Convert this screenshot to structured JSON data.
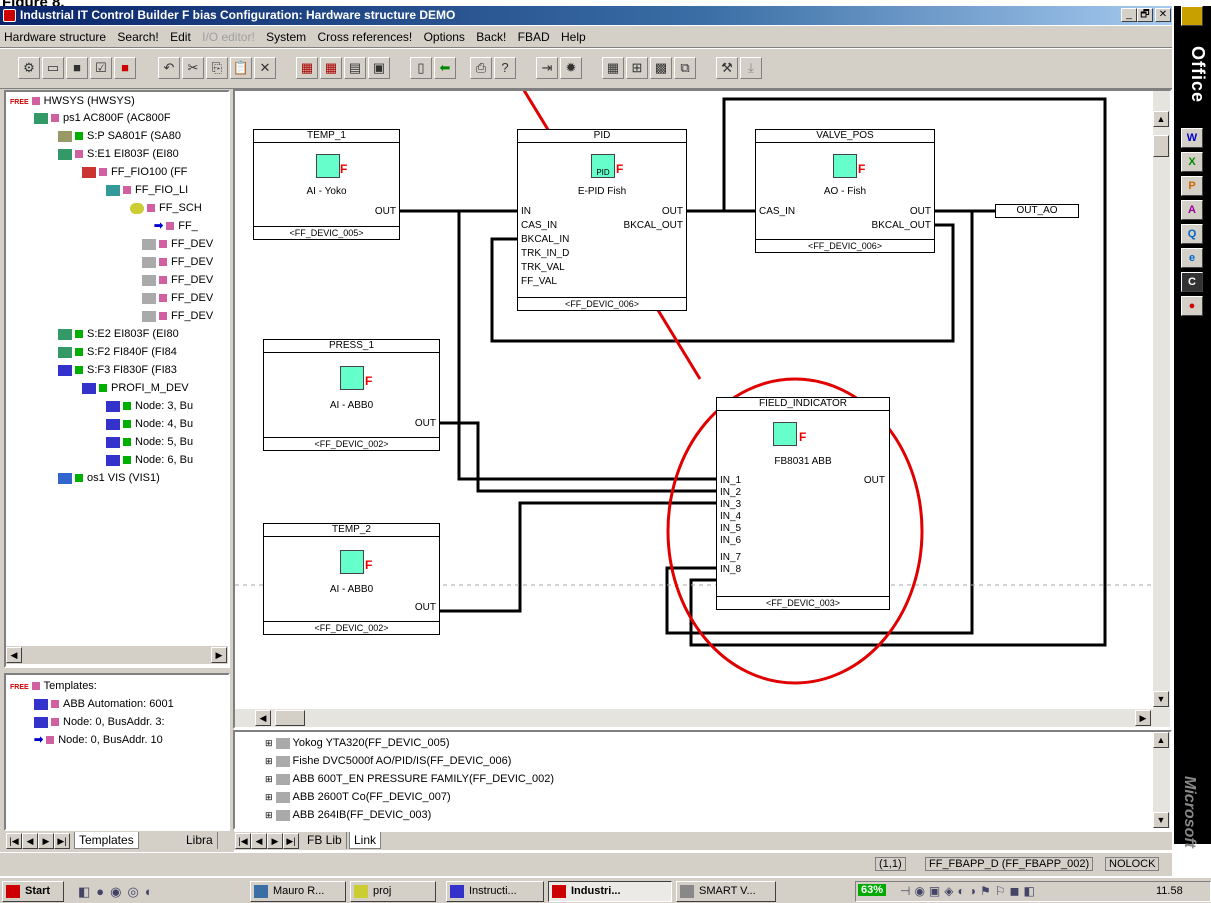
{
  "figure_label": "Figure 8.",
  "window": {
    "title": "Industrial IT Control Builder F bias  Configuration: Hardware structure  DEMO",
    "controls": [
      "_",
      "🗗",
      "✕"
    ]
  },
  "menu": [
    "Hardware structure",
    "Search!",
    "Edit",
    "I/O editor!",
    "System",
    "Cross references!",
    "Options",
    "Back!",
    "FBAD",
    "Help"
  ],
  "hw_tree": [
    {
      "label": "HWSYS (HWSYS)",
      "color": "pink",
      "prefix": "FREE"
    },
    {
      "label": "ps1  AC800F (AC800F",
      "color": "pink"
    },
    {
      "label": "S:P  SA801F (SA80",
      "color": "green"
    },
    {
      "label": "S:E1  EI803F (EI80",
      "color": "pink"
    },
    {
      "label": "FF_FIO100 (FF",
      "color": "pink"
    },
    {
      "label": "FF_FIO_LI",
      "color": "pink"
    },
    {
      "label": "FF_SCH",
      "color": "pink"
    },
    {
      "label": "FF_",
      "color": "pink"
    },
    {
      "label": "FF_DEV",
      "color": "pink"
    },
    {
      "label": "FF_DEV",
      "color": "pink"
    },
    {
      "label": "FF_DEV",
      "color": "pink"
    },
    {
      "label": "FF_DEV",
      "color": "pink"
    },
    {
      "label": "FF_DEV",
      "color": "pink"
    },
    {
      "label": "S:E2  EI803F (EI80",
      "color": "green"
    },
    {
      "label": "S:F2  FI840F (FI84",
      "color": "green"
    },
    {
      "label": "S:F3  FI830F (FI83",
      "color": "green"
    },
    {
      "label": "PROFI_M_DEV",
      "color": "green"
    },
    {
      "label": "Node: 3, Bu",
      "color": "green"
    },
    {
      "label": "Node: 4, Bu",
      "color": "green"
    },
    {
      "label": "Node: 5, Bu",
      "color": "green"
    },
    {
      "label": "Node: 6, Bu",
      "color": "green"
    },
    {
      "label": "os1  VIS (VIS1)",
      "color": "green"
    }
  ],
  "templates_tree": [
    {
      "label": "Templates:",
      "prefix": "FREE"
    },
    {
      "label": "ABB Automation: 6001"
    },
    {
      "label": "Node: 0, BusAddr. 3:"
    },
    {
      "label": "Node: 0, BusAddr. 10"
    }
  ],
  "left_tabs": [
    "Templates",
    "Libra"
  ],
  "blocks": {
    "temp1": {
      "title": "TEMP_1",
      "name": "AI - Yoko",
      "out": "OUT",
      "footer": "<FF_DEVIC_005>"
    },
    "pid": {
      "title": "PID",
      "name": "E-PID Fish",
      "inputs": [
        "IN",
        "CAS_IN",
        "BKCAL_IN",
        "TRK_IN_D",
        "TRK_VAL",
        "FF_VAL"
      ],
      "out1": "OUT",
      "out2": "BKCAL_OUT",
      "footer": "<FF_DEVIC_006>",
      "icon": "PID"
    },
    "valve": {
      "title": "VALVE_POS",
      "name": "AO - Fish",
      "in": "CAS_IN",
      "out1": "OUT",
      "out2": "BKCAL_OUT",
      "footer": "<FF_DEVIC_006>"
    },
    "out_ao": {
      "label": "OUT_AO"
    },
    "press1": {
      "title": "PRESS_1",
      "name": "AI - ABB0",
      "out": "OUT",
      "footer": "<FF_DEVIC_002>"
    },
    "temp2": {
      "title": "TEMP_2",
      "name": "AI - ABB0",
      "out": "OUT",
      "footer": "<FF_DEVIC_002>"
    },
    "field": {
      "title": "FIELD_INDICATOR",
      "name": "FB8031 ABB",
      "inputs": [
        "IN_1",
        "IN_2",
        "IN_3",
        "IN_4",
        "IN_5",
        "IN_6",
        "IN_7",
        "IN_8"
      ],
      "out": "OUT",
      "footer": "<FF_DEVIC_003>"
    }
  },
  "devices": [
    "Yokog YTA320(FF_DEVIC_005)",
    "Fishe DVC5000f AO/PID/IS(FF_DEVIC_006)",
    "ABB 600T_EN PRESSURE FAMILY(FF_DEVIC_002)",
    "ABB 2600T Co(FF_DEVIC_007)",
    "ABB 264IB(FF_DEVIC_003)"
  ],
  "bottom_tabs": [
    "FB Lib",
    "Link"
  ],
  "status": {
    "pos": "(1,1)",
    "item": "FF_FBAPP_D (FF_FBAPP_002)",
    "lock": "NOLOCK"
  },
  "office": {
    "title": "Office",
    "footer": "Microsoft"
  },
  "taskbar": {
    "start": "Start",
    "tasks": [
      "Mauro R...",
      "proj",
      "Instructi...",
      "Industri...",
      "SMART V..."
    ],
    "battery": "63%",
    "clock": "11.58"
  },
  "colors": {
    "titlebar": "#0a246a",
    "annotation": "#e00000",
    "fb_icon": "#66ffcc"
  }
}
